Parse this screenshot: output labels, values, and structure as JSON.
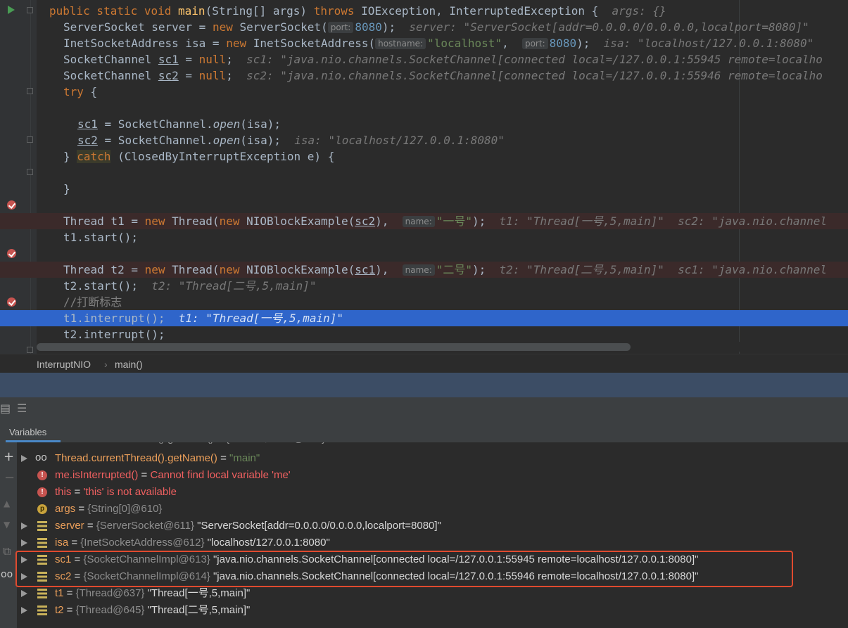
{
  "editor": {
    "lines": [
      {
        "segments": [
          {
            "t": "public static void ",
            "c": "kw"
          },
          {
            "t": "main",
            "c": "fn"
          },
          {
            "t": "(String[] args) ",
            "c": ""
          },
          {
            "t": "throws ",
            "c": "kw"
          },
          {
            "t": "IOException, InterruptedException {  ",
            "c": ""
          },
          {
            "t": "args: {}",
            "c": "inl"
          }
        ]
      },
      {
        "segments": [
          {
            "t": "ServerSocket ",
            "c": ""
          },
          {
            "t": "server = ",
            "c": ""
          },
          {
            "t": "new ",
            "c": "kw"
          },
          {
            "t": "ServerSocket(",
            "c": ""
          },
          {
            "t": "port:",
            "c": "hint"
          },
          {
            "t": "8080",
            "c": "num"
          },
          {
            "t": ");  ",
            "c": ""
          },
          {
            "t": "server: \"ServerSocket[addr=0.0.0.0/0.0.0.0,localport=8080]\"",
            "c": "inl"
          }
        ]
      },
      {
        "segments": [
          {
            "t": "InetSocketAddress isa = ",
            "c": ""
          },
          {
            "t": "new ",
            "c": "kw"
          },
          {
            "t": "InetSocketAddress(",
            "c": ""
          },
          {
            "t": "hostname:",
            "c": "hint"
          },
          {
            "t": "\"localhost\"",
            "c": "str"
          },
          {
            "t": ",  ",
            "c": ""
          },
          {
            "t": "port:",
            "c": "hint"
          },
          {
            "t": "8080",
            "c": "num"
          },
          {
            "t": ");  ",
            "c": ""
          },
          {
            "t": "isa: \"localhost/127.0.0.1:8080\"",
            "c": "inl"
          }
        ]
      },
      {
        "segments": [
          {
            "t": "SocketChannel ",
            "c": ""
          },
          {
            "t": "sc1",
            "c": "ul"
          },
          {
            "t": " = ",
            "c": ""
          },
          {
            "t": "null",
            "c": "kw"
          },
          {
            "t": ";  ",
            "c": ""
          },
          {
            "t": "sc1: \"java.nio.channels.SocketChannel[connected local=/127.0.0.1:55945 remote=localho",
            "c": "inl"
          }
        ]
      },
      {
        "segments": [
          {
            "t": "SocketChannel ",
            "c": ""
          },
          {
            "t": "sc2",
            "c": "ul"
          },
          {
            "t": " = ",
            "c": ""
          },
          {
            "t": "null",
            "c": "kw"
          },
          {
            "t": ";  ",
            "c": ""
          },
          {
            "t": "sc2: \"java.nio.channels.SocketChannel[connected local=/127.0.0.1:55946 remote=localho",
            "c": "inl"
          }
        ]
      },
      {
        "segments": [
          {
            "t": "try ",
            "c": "kw"
          },
          {
            "t": "{",
            "c": ""
          }
        ]
      },
      {
        "segments": [
          {
            "t": "sc1",
            "c": "ul"
          },
          {
            "t": " = SocketChannel.",
            "c": ""
          },
          {
            "t": "open",
            "c": "it"
          },
          {
            "t": "(isa);",
            "c": ""
          }
        ]
      },
      {
        "segments": [
          {
            "t": "sc2",
            "c": "ul"
          },
          {
            "t": " = SocketChannel.",
            "c": ""
          },
          {
            "t": "open",
            "c": "it"
          },
          {
            "t": "(isa);  ",
            "c": ""
          },
          {
            "t": "isa: \"localhost/127.0.0.1:8080\"",
            "c": "inl"
          }
        ]
      },
      {
        "segments": [
          {
            "t": "} ",
            "c": ""
          },
          {
            "t": "catch",
            "c": "catch"
          },
          {
            "t": " (ClosedByInterruptException e) {",
            "c": ""
          }
        ]
      },
      {
        "segments": []
      },
      {
        "segments": [
          {
            "t": "}",
            "c": ""
          }
        ]
      },
      {
        "segments": []
      },
      {
        "segments": [
          {
            "t": "Thread t1 = ",
            "c": ""
          },
          {
            "t": "new ",
            "c": "kw"
          },
          {
            "t": "Thread(",
            "c": ""
          },
          {
            "t": "new ",
            "c": "kw"
          },
          {
            "t": "NIOBlockExample(",
            "c": ""
          },
          {
            "t": "sc2",
            "c": "ul"
          },
          {
            "t": "),  ",
            "c": ""
          },
          {
            "t": "name:",
            "c": "hint"
          },
          {
            "t": "\"一号\"",
            "c": "str"
          },
          {
            "t": ");  ",
            "c": ""
          },
          {
            "t": "t1: \"Thread[一号,5,main]\"  sc2: \"java.nio.channel",
            "c": "inl"
          }
        ]
      },
      {
        "segments": [
          {
            "t": "t1.start();",
            "c": ""
          }
        ]
      },
      {
        "segments": []
      },
      {
        "segments": [
          {
            "t": "Thread t2 = ",
            "c": ""
          },
          {
            "t": "new ",
            "c": "kw"
          },
          {
            "t": "Thread(",
            "c": ""
          },
          {
            "t": "new ",
            "c": "kw"
          },
          {
            "t": "NIOBlockExample(",
            "c": ""
          },
          {
            "t": "sc1",
            "c": "ul"
          },
          {
            "t": "),  ",
            "c": ""
          },
          {
            "t": "name:",
            "c": "hint"
          },
          {
            "t": "\"二号\"",
            "c": "str"
          },
          {
            "t": ");  ",
            "c": ""
          },
          {
            "t": "t2: \"Thread[二号,5,main]\"  sc1: \"java.nio.channel",
            "c": "inl"
          }
        ]
      },
      {
        "segments": [
          {
            "t": "t2.start();  ",
            "c": ""
          },
          {
            "t": "t2: \"Thread[二号,5,main]\"",
            "c": "inl"
          }
        ]
      },
      {
        "segments": [
          {
            "t": "//打断标志",
            "c": "cmt"
          }
        ]
      },
      {
        "segments": [
          {
            "t": "t1.interrupt();  ",
            "c": ""
          },
          {
            "t": "t1: \"Thread[一号,5,main]\"",
            "c": "inl"
          }
        ]
      },
      {
        "segments": [
          {
            "t": "t2.interrupt();",
            "c": ""
          }
        ]
      }
    ]
  },
  "breadcrumb": {
    "class_name": "InterruptNIO",
    "separator": "›",
    "method_name": "main()"
  },
  "debug": {
    "tab_label": "Variables",
    "variables": [
      {
        "icon": "watch-icon",
        "arrow": true,
        "name": "Thread.currentThread().getName()",
        "name_color": "orange",
        "eq": " = ",
        "ref": "",
        "value": "\"main\"",
        "value_kind": "string"
      },
      {
        "icon": "error-icon",
        "arrow": false,
        "name": "me.isInterrupted()",
        "name_color": "red",
        "eq": " = ",
        "ref": "",
        "value": "Cannot find local variable 'me'",
        "value_kind": "error"
      },
      {
        "icon": "error-icon",
        "arrow": false,
        "name": "this",
        "name_color": "red",
        "eq": " = ",
        "ref": "",
        "value": "'this' is not available",
        "value_kind": "error"
      },
      {
        "icon": "param-icon",
        "arrow": false,
        "name": "args",
        "name_color": "orange",
        "eq": " = ",
        "ref": "{String[0]@610}",
        "value": "",
        "value_kind": "plain"
      },
      {
        "icon": "field-icon",
        "arrow": true,
        "name": "server",
        "name_color": "orange",
        "eq": " = ",
        "ref": "{ServerSocket@611}",
        "value": " \"ServerSocket[addr=0.0.0.0/0.0.0.0,localport=8080]\"",
        "value_kind": "plain"
      },
      {
        "icon": "field-icon",
        "arrow": true,
        "name": "isa",
        "name_color": "orange",
        "eq": " = ",
        "ref": "{InetSocketAddress@612}",
        "value": " \"localhost/127.0.0.1:8080\"",
        "value_kind": "plain"
      },
      {
        "icon": "field-icon",
        "arrow": true,
        "name": "sc1",
        "name_color": "orange",
        "eq": " = ",
        "ref": "{SocketChannelImpl@613}",
        "value": " \"java.nio.channels.SocketChannel[connected local=/127.0.0.1:55945 remote=localhost/127.0.0.1:8080]\"",
        "value_kind": "plain"
      },
      {
        "icon": "field-icon",
        "arrow": true,
        "name": "sc2",
        "name_color": "orange",
        "eq": " = ",
        "ref": "{SocketChannelImpl@614}",
        "value": " \"java.nio.channels.SocketChannel[connected local=/127.0.0.1:55946 remote=localhost/127.0.0.1:8080]\"",
        "value_kind": "plain"
      },
      {
        "icon": "field-icon",
        "arrow": true,
        "name": "t1",
        "name_color": "orange",
        "eq": " = ",
        "ref": "{Thread@637}",
        "value": " \"Thread[一号,5,main]\"",
        "value_kind": "plain"
      },
      {
        "icon": "field-icon",
        "arrow": true,
        "name": "t2",
        "name_color": "orange",
        "eq": " = ",
        "ref": "{Thread@645}",
        "value": " \"Thread[二号,5,main]\"",
        "value_kind": "plain"
      }
    ]
  },
  "colors": {
    "accent": "#2f65ca",
    "highlight_box": "#e04a2f",
    "breakpoint": "#c75450"
  }
}
